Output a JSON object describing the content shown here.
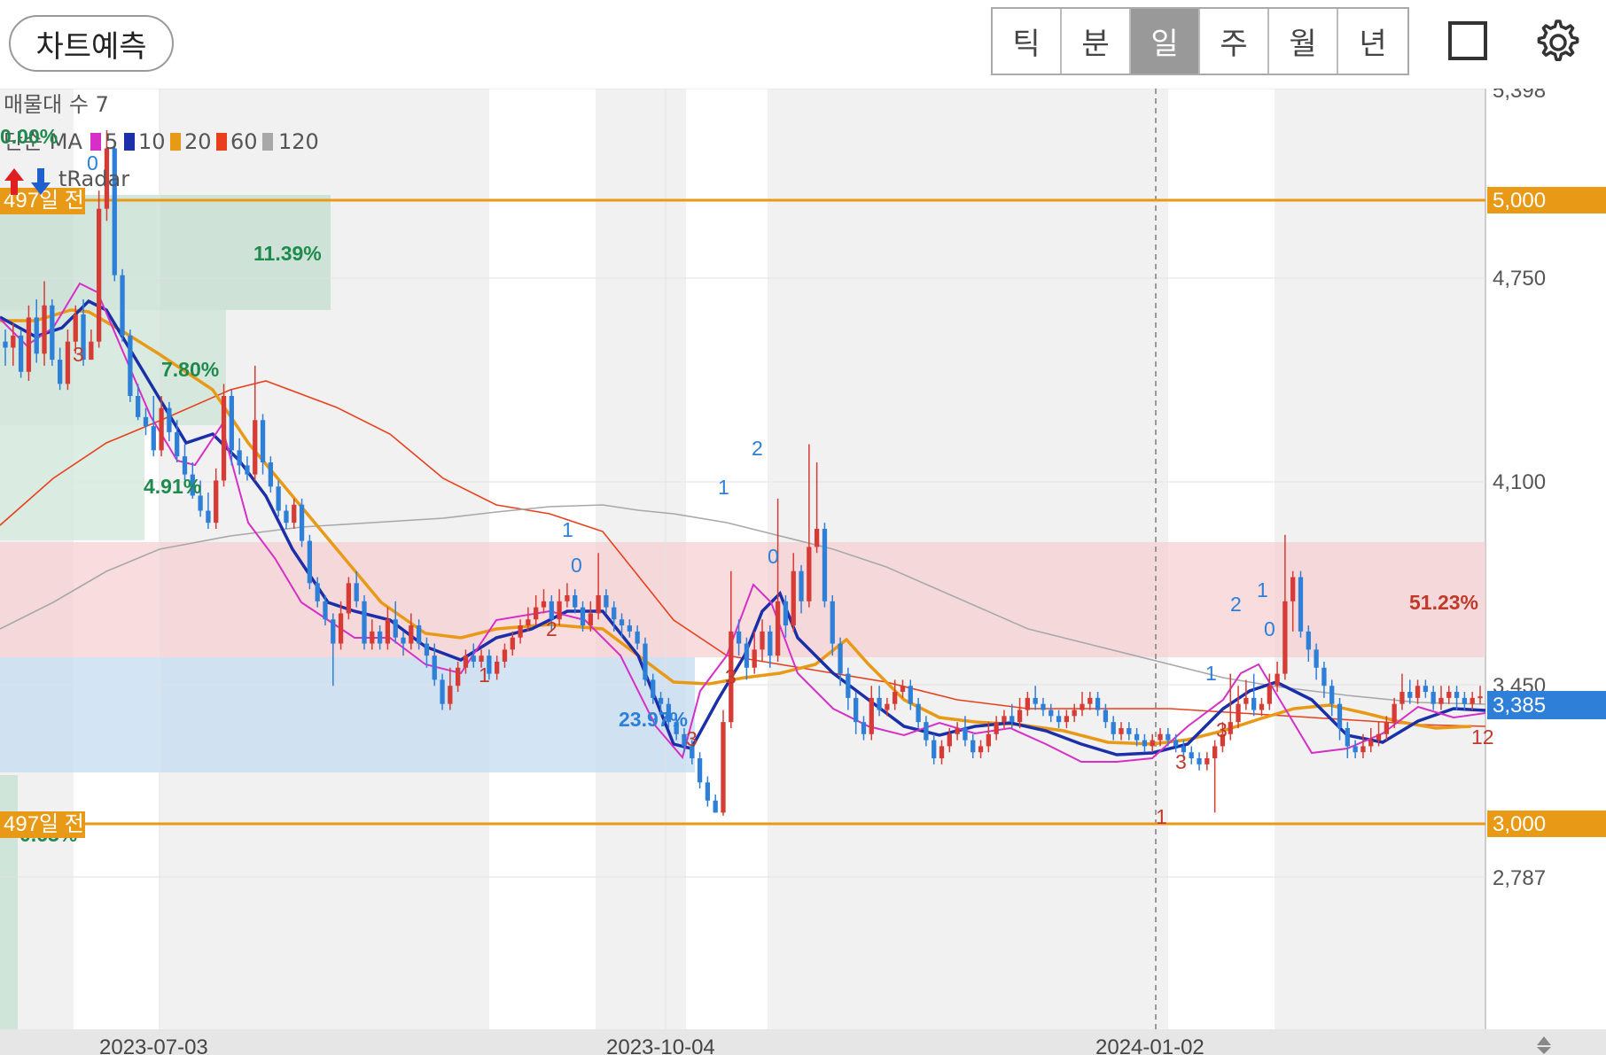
{
  "toolbar": {
    "predict_button": "차트예측",
    "periods": [
      "틱",
      "분",
      "일",
      "주",
      "월",
      "년"
    ],
    "active_period": "일"
  },
  "chart_info": {
    "volume_profile": "매물대 수 7",
    "ma_label": "단순 MA",
    "ma_periods": [
      "5",
      "10",
      "20",
      "60",
      "120"
    ],
    "ma_colors": [
      "#d62fc7",
      "#1a2fa8",
      "#e89a16",
      "#e8401c",
      "#a8a8a8"
    ],
    "indicator": "tRadar",
    "pct_top_left": "0.00%"
  },
  "chart_data": {
    "type": "candlestick",
    "y_ticks": [
      "5,398",
      "4,750",
      "4,100",
      "3,450",
      "2,787"
    ],
    "y_range": [
      2787,
      5398
    ],
    "x_ticks": [
      "2023-07-03",
      "2023-10-04",
      "2024-01-02"
    ],
    "current_price": "3,385",
    "reference_lines": [
      {
        "price": 5000,
        "label": "5,000",
        "tag": "497일 전"
      },
      {
        "price": 3000,
        "label": "3,000",
        "tag": "497일 전"
      }
    ],
    "zone_labels": [
      "11.39%",
      "7.80%",
      "4.91%",
      "0.63%",
      "51.23%",
      "23.97%"
    ],
    "colors": {
      "up": "#d63b35",
      "down": "#2d7fd8",
      "ref_line": "#e89a16",
      "current": "#2d7fd8"
    },
    "candles": [
      [
        4560,
        4540,
        4600,
        4480
      ],
      [
        4540,
        4580,
        4620,
        4480
      ],
      [
        4580,
        4460,
        4600,
        4440
      ],
      [
        4460,
        4640,
        4680,
        4430
      ],
      [
        4640,
        4520,
        4700,
        4490
      ],
      [
        4520,
        4680,
        4760,
        4480
      ],
      [
        4680,
        4500,
        4700,
        4480
      ],
      [
        4500,
        4420,
        4540,
        4400
      ],
      [
        4420,
        4560,
        4600,
        4400
      ],
      [
        4560,
        4650,
        4680,
        4520
      ],
      [
        4650,
        4500,
        4700,
        4480
      ],
      [
        4500,
        4560,
        4600,
        4500
      ],
      [
        4560,
        5000,
        5060,
        4540
      ],
      [
        5000,
        5200,
        5260,
        4960
      ],
      [
        5200,
        4780,
        5220,
        4760
      ],
      [
        4780,
        4580,
        4800,
        4560
      ],
      [
        4580,
        4380,
        4600,
        4360
      ],
      [
        4380,
        4310,
        4420,
        4300
      ],
      [
        4310,
        4280,
        4340,
        4250
      ],
      [
        4280,
        4200,
        4380,
        4180
      ],
      [
        4200,
        4340,
        4380,
        4180
      ],
      [
        4340,
        4260,
        4360,
        4230
      ],
      [
        4260,
        4180,
        4300,
        4160
      ],
      [
        4180,
        4120,
        4220,
        4100
      ],
      [
        4120,
        4050,
        4160,
        4040
      ],
      [
        4050,
        4000,
        4100,
        3980
      ],
      [
        4000,
        3960,
        4060,
        3940
      ],
      [
        3960,
        4100,
        4140,
        3940
      ],
      [
        4100,
        4380,
        4420,
        4080
      ],
      [
        4380,
        4200,
        4400,
        4150
      ],
      [
        4200,
        4150,
        4240,
        4120
      ],
      [
        4150,
        4120,
        4180,
        4100
      ],
      [
        4120,
        4300,
        4480,
        4100
      ],
      [
        4300,
        4160,
        4320,
        4120
      ],
      [
        4160,
        4080,
        4180,
        4060
      ],
      [
        4080,
        4000,
        4100,
        3980
      ],
      [
        4000,
        3960,
        4020,
        3940
      ],
      [
        3960,
        4020,
        4040,
        3940
      ],
      [
        4020,
        3900,
        4040,
        3880
      ],
      [
        3900,
        3760,
        3920,
        3740
      ],
      [
        3760,
        3700,
        3780,
        3680
      ],
      [
        3700,
        3640,
        3720,
        3620
      ],
      [
        3640,
        3560,
        3660,
        3420
      ],
      [
        3560,
        3660,
        3700,
        3540
      ],
      [
        3660,
        3760,
        3780,
        3640
      ],
      [
        3760,
        3700,
        3800,
        3680
      ],
      [
        3700,
        3560,
        3720,
        3540
      ],
      [
        3560,
        3600,
        3640,
        3540
      ],
      [
        3600,
        3560,
        3620,
        3540
      ],
      [
        3560,
        3640,
        3680,
        3540
      ],
      [
        3640,
        3580,
        3700,
        3560
      ],
      [
        3580,
        3560,
        3600,
        3520
      ],
      [
        3560,
        3620,
        3660,
        3540
      ],
      [
        3620,
        3560,
        3640,
        3540
      ],
      [
        3560,
        3520,
        3580,
        3480
      ],
      [
        3520,
        3440,
        3560,
        3420
      ],
      [
        3440,
        3360,
        3460,
        3340
      ],
      [
        3360,
        3420,
        3480,
        3340
      ],
      [
        3420,
        3480,
        3500,
        3400
      ],
      [
        3480,
        3520,
        3540,
        3460
      ],
      [
        3520,
        3500,
        3560,
        3480
      ],
      [
        3500,
        3520,
        3540,
        3480
      ],
      [
        3520,
        3460,
        3540,
        3440
      ],
      [
        3460,
        3500,
        3520,
        3440
      ],
      [
        3500,
        3540,
        3560,
        3480
      ],
      [
        3540,
        3580,
        3600,
        3520
      ],
      [
        3580,
        3620,
        3640,
        3560
      ],
      [
        3620,
        3640,
        3680,
        3600
      ],
      [
        3640,
        3680,
        3720,
        3620
      ],
      [
        3680,
        3700,
        3740,
        3660
      ],
      [
        3700,
        3640,
        3720,
        3600
      ],
      [
        3640,
        3700,
        3740,
        3620
      ],
      [
        3700,
        3720,
        3760,
        3680
      ],
      [
        3720,
        3680,
        3740,
        3660
      ],
      [
        3680,
        3620,
        3700,
        3600
      ],
      [
        3620,
        3660,
        3700,
        3600
      ],
      [
        3660,
        3720,
        3860,
        3640
      ],
      [
        3720,
        3680,
        3740,
        3660
      ],
      [
        3680,
        3640,
        3700,
        3600
      ],
      [
        3640,
        3620,
        3660,
        3580
      ],
      [
        3620,
        3600,
        3640,
        3580
      ],
      [
        3600,
        3560,
        3620,
        3540
      ],
      [
        3560,
        3440,
        3580,
        3420
      ],
      [
        3440,
        3380,
        3460,
        3360
      ],
      [
        3380,
        3360,
        3400,
        3320
      ],
      [
        3360,
        3300,
        3380,
        3280
      ],
      [
        3300,
        3260,
        3320,
        3240
      ],
      [
        3260,
        3220,
        3280,
        3200
      ],
      [
        3220,
        3180,
        3240,
        3160
      ],
      [
        3180,
        3100,
        3200,
        3080
      ],
      [
        3100,
        3040,
        3120,
        3020
      ],
      [
        3040,
        3000,
        3060,
        3000
      ],
      [
        3000,
        3300,
        3340,
        2990
      ],
      [
        3300,
        3600,
        3800,
        3280
      ],
      [
        3600,
        3560,
        3640,
        3520
      ],
      [
        3560,
        3480,
        3580,
        3440
      ],
      [
        3480,
        3540,
        3600,
        3460
      ],
      [
        3540,
        3600,
        3640,
        3500
      ],
      [
        3600,
        3520,
        3620,
        3480
      ],
      [
        3520,
        3700,
        4040,
        3500
      ],
      [
        3700,
        3620,
        3720,
        3580
      ],
      [
        3620,
        3800,
        3860,
        3600
      ],
      [
        3800,
        3700,
        3820,
        3660
      ],
      [
        3700,
        3880,
        4220,
        3680
      ],
      [
        3880,
        3940,
        4160,
        3860
      ],
      [
        3940,
        3700,
        3960,
        3680
      ],
      [
        3700,
        3560,
        3720,
        3520
      ],
      [
        3560,
        3460,
        3580,
        3420
      ],
      [
        3460,
        3380,
        3480,
        3340
      ],
      [
        3380,
        3300,
        3400,
        3260
      ],
      [
        3300,
        3260,
        3320,
        3240
      ],
      [
        3260,
        3380,
        3420,
        3240
      ],
      [
        3380,
        3340,
        3420,
        3320
      ],
      [
        3340,
        3360,
        3380,
        3320
      ],
      [
        3360,
        3400,
        3440,
        3340
      ],
      [
        3400,
        3420,
        3440,
        3380
      ],
      [
        3420,
        3360,
        3440,
        3340
      ],
      [
        3360,
        3300,
        3380,
        3280
      ],
      [
        3300,
        3240,
        3320,
        3220
      ],
      [
        3240,
        3180,
        3260,
        3160
      ],
      [
        3180,
        3220,
        3240,
        3160
      ],
      [
        3220,
        3260,
        3280,
        3200
      ],
      [
        3260,
        3280,
        3300,
        3240
      ],
      [
        3280,
        3240,
        3320,
        3220
      ],
      [
        3240,
        3200,
        3260,
        3180
      ],
      [
        3200,
        3220,
        3240,
        3180
      ],
      [
        3220,
        3260,
        3300,
        3200
      ],
      [
        3260,
        3300,
        3320,
        3240
      ],
      [
        3300,
        3320,
        3340,
        3280
      ],
      [
        3320,
        3300,
        3360,
        3280
      ],
      [
        3300,
        3340,
        3380,
        3280
      ],
      [
        3340,
        3380,
        3400,
        3320
      ],
      [
        3380,
        3360,
        3420,
        3340
      ],
      [
        3360,
        3340,
        3380,
        3320
      ],
      [
        3340,
        3320,
        3360,
        3300
      ],
      [
        3320,
        3300,
        3340,
        3280
      ],
      [
        3300,
        3320,
        3340,
        3280
      ],
      [
        3320,
        3340,
        3360,
        3300
      ],
      [
        3340,
        3360,
        3400,
        3320
      ],
      [
        3360,
        3380,
        3400,
        3340
      ],
      [
        3380,
        3340,
        3400,
        3320
      ],
      [
        3340,
        3300,
        3360,
        3280
      ],
      [
        3300,
        3260,
        3320,
        3240
      ],
      [
        3260,
        3280,
        3300,
        3240
      ],
      [
        3280,
        3260,
        3300,
        3240
      ],
      [
        3260,
        3240,
        3280,
        3220
      ],
      [
        3240,
        3220,
        3260,
        3200
      ],
      [
        3220,
        3240,
        3260,
        3200
      ],
      [
        3240,
        3260,
        3280,
        3220
      ],
      [
        3260,
        3240,
        3280,
        3220
      ],
      [
        3240,
        3220,
        3260,
        3200
      ],
      [
        3220,
        3200,
        3240,
        3180
      ],
      [
        3200,
        3180,
        3220,
        3160
      ],
      [
        3180,
        3160,
        3200,
        3140
      ],
      [
        3160,
        3180,
        3200,
        3140
      ],
      [
        3180,
        3220,
        3240,
        3000
      ],
      [
        3220,
        3260,
        3300,
        3200
      ],
      [
        3260,
        3300,
        3460,
        3240
      ],
      [
        3300,
        3360,
        3420,
        3280
      ],
      [
        3360,
        3380,
        3440,
        3340
      ],
      [
        3380,
        3340,
        3460,
        3320
      ],
      [
        3340,
        3360,
        3380,
        3320
      ],
      [
        3360,
        3420,
        3460,
        3340
      ],
      [
        3420,
        3460,
        3500,
        3400
      ],
      [
        3460,
        3700,
        3920,
        3440
      ],
      [
        3700,
        3780,
        3800,
        3600
      ],
      [
        3780,
        3600,
        3800,
        3580
      ],
      [
        3600,
        3540,
        3620,
        3500
      ],
      [
        3540,
        3480,
        3560,
        3440
      ],
      [
        3480,
        3420,
        3500,
        3380
      ],
      [
        3420,
        3360,
        3440,
        3320
      ],
      [
        3360,
        3280,
        3380,
        3240
      ],
      [
        3280,
        3220,
        3300,
        3180
      ],
      [
        3220,
        3200,
        3240,
        3180
      ],
      [
        3200,
        3220,
        3260,
        3180
      ],
      [
        3220,
        3240,
        3280,
        3200
      ],
      [
        3240,
        3260,
        3300,
        3220
      ],
      [
        3260,
        3300,
        3320,
        3240
      ],
      [
        3300,
        3360,
        3380,
        3280
      ],
      [
        3360,
        3400,
        3460,
        3340
      ],
      [
        3400,
        3380,
        3440,
        3360
      ],
      [
        3380,
        3420,
        3440,
        3360
      ],
      [
        3420,
        3400,
        3440,
        3380
      ],
      [
        3400,
        3360,
        3420,
        3340
      ],
      [
        3360,
        3380,
        3420,
        3340
      ],
      [
        3380,
        3400,
        3420,
        3360
      ],
      [
        3400,
        3380,
        3420,
        3340
      ],
      [
        3380,
        3360,
        3400,
        3340
      ],
      [
        3360,
        3380,
        3400,
        3340
      ],
      [
        3380,
        3385,
        3420,
        3360
      ]
    ]
  }
}
